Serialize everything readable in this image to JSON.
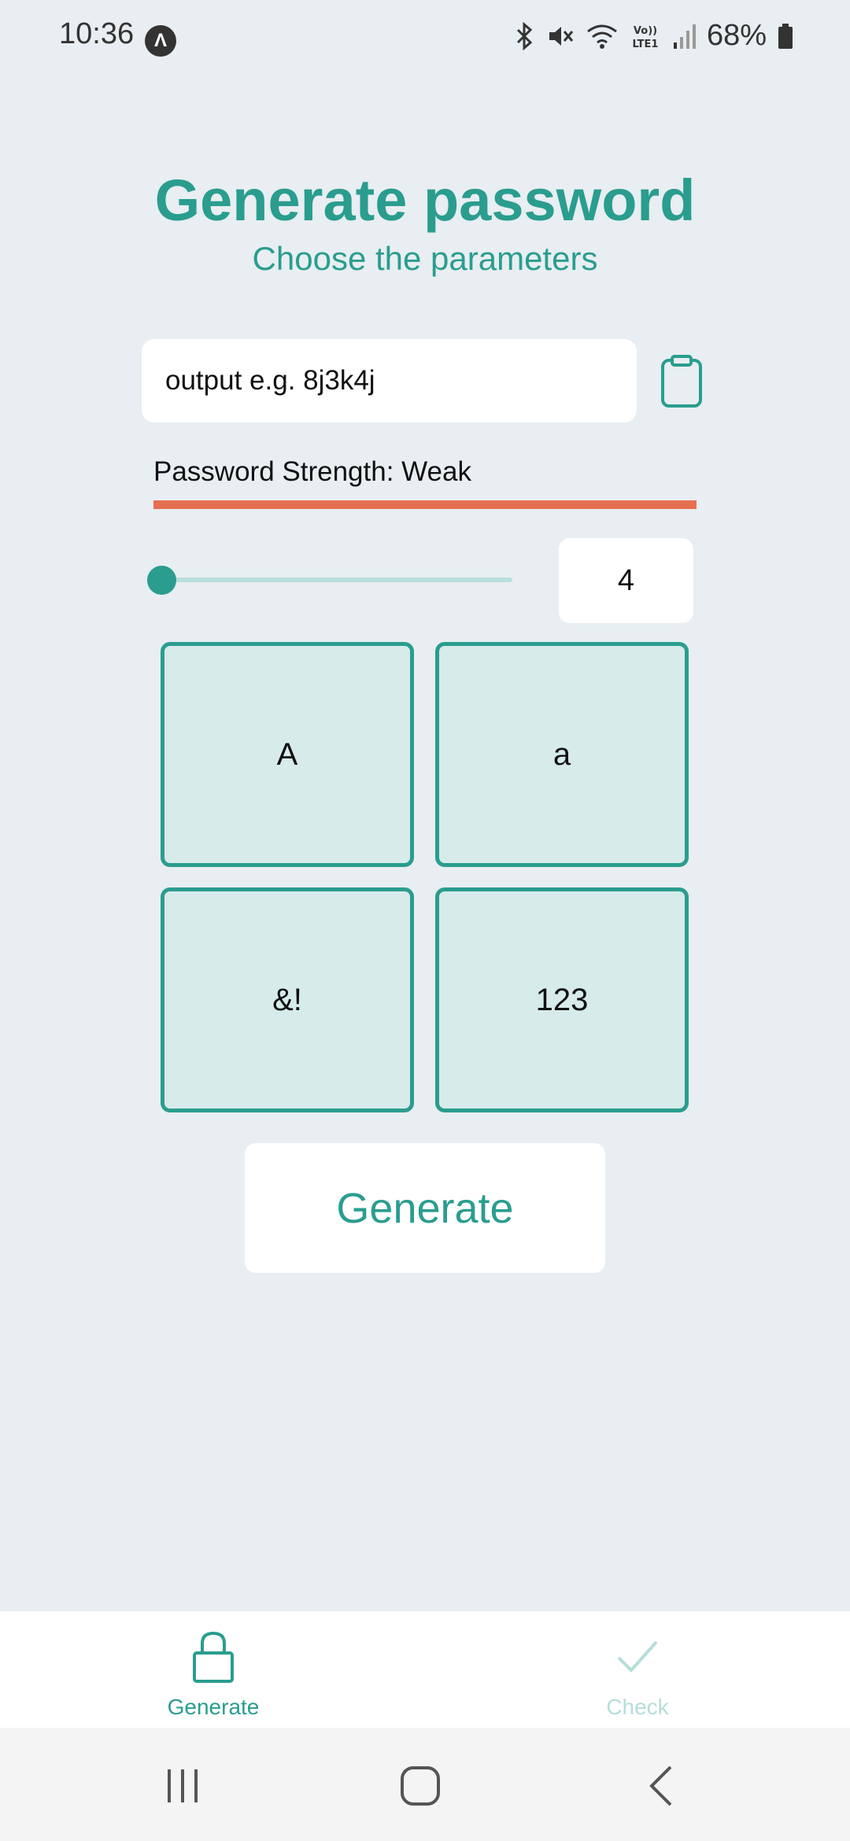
{
  "status_bar": {
    "time": "10:36",
    "app_icon": "expo-icon",
    "battery": "68%",
    "icons": [
      "bluetooth-icon",
      "mute-icon",
      "wifi-icon",
      "volte-icon",
      "signal-icon",
      "battery-icon"
    ]
  },
  "header": {
    "title": "Generate password",
    "subtitle": "Choose the parameters"
  },
  "output": {
    "placeholder": "output e.g. 8j3k4j"
  },
  "strength": {
    "label": "Password Strength: Weak",
    "bar_color": "#e76f51"
  },
  "length": {
    "value": "4",
    "slider_fraction": 0
  },
  "options": [
    {
      "label": "A"
    },
    {
      "label": "a"
    },
    {
      "label": "&!"
    },
    {
      "label": "123"
    }
  ],
  "generate_button": {
    "label": "Generate"
  },
  "tabs": [
    {
      "label": "Generate",
      "icon": "lock-icon",
      "active": true
    },
    {
      "label": "Check",
      "icon": "check-icon",
      "active": false
    }
  ],
  "colors": {
    "accent": "#2a9d8f",
    "background": "#e8eef1",
    "tile_fill": "#d6ebea",
    "inactive_tab": "#b6ddd9"
  }
}
